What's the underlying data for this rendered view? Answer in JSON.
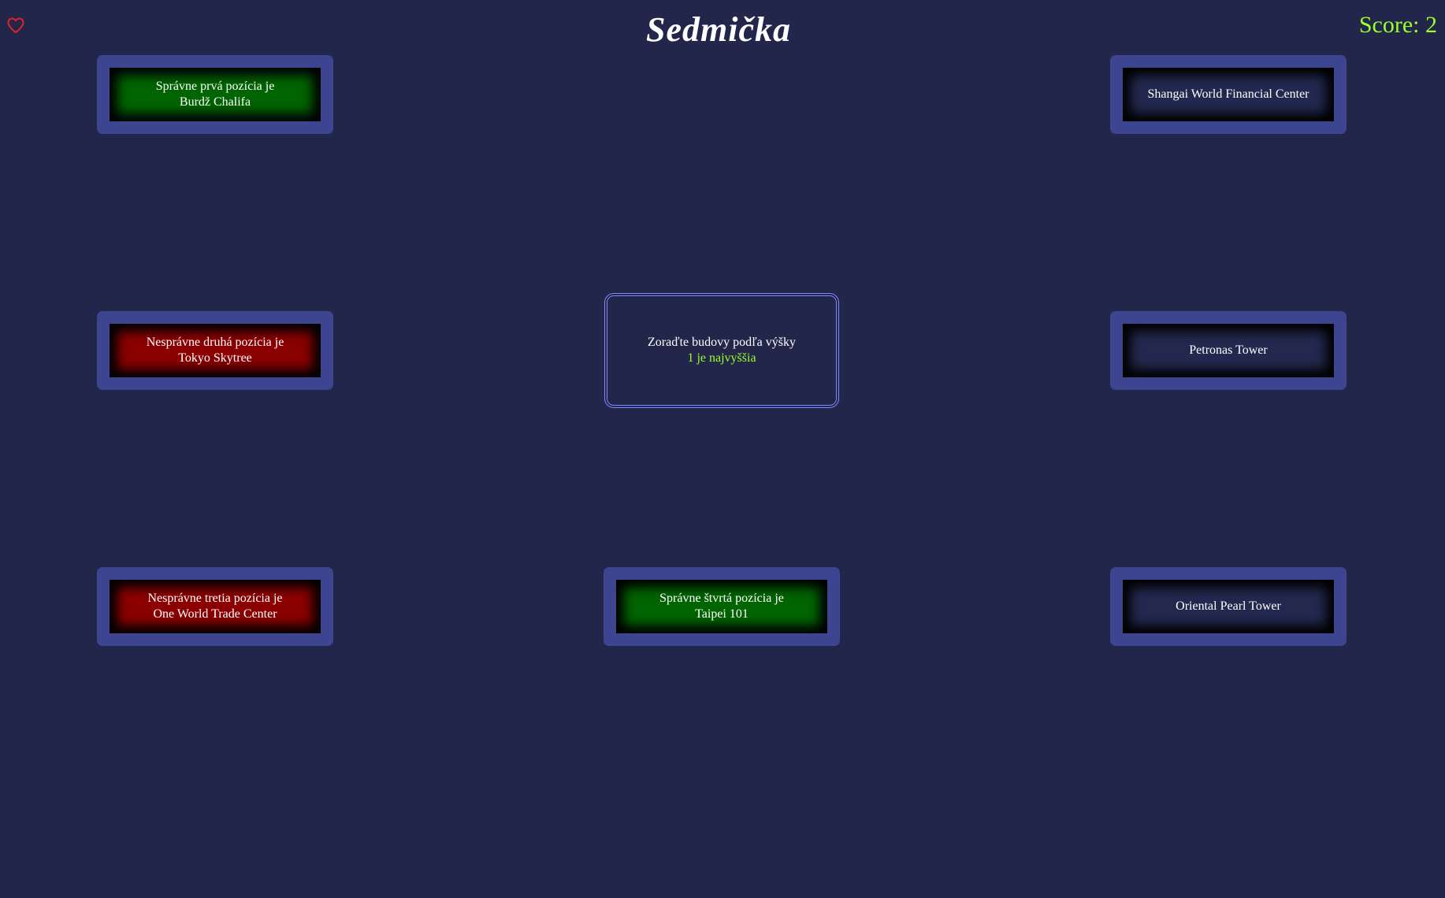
{
  "game": {
    "title": "Sedmička",
    "score_text": "Score: 2",
    "heart_icon": "heart-outline-icon",
    "colors": {
      "background": "#22264a",
      "card_frame": "#3d4490",
      "correct": "#006400",
      "wrong": "#8b0000",
      "accent": "#9aff2a",
      "heart": "#e0202a"
    }
  },
  "center": {
    "instruction": "Zoraďte budovy podľa výšky",
    "hint": "1 je najvyššia"
  },
  "cards": {
    "top_left": {
      "line1": "Správne prvá pozícia je",
      "line2": "Burdž Chalifa",
      "state": "correct"
    },
    "mid_left": {
      "line1": "Nesprávne druhá pozícia je",
      "line2": "Tokyo Skytree",
      "state": "wrong"
    },
    "bottom_left": {
      "line1": "Nesprávne tretia pozícia je",
      "line2": "One World Trade Center",
      "state": "wrong"
    },
    "bottom_mid": {
      "line1": "Správne štvrtá pozícia je",
      "line2": "Taipei 101",
      "state": "correct"
    },
    "top_right": {
      "label": "Shangai World Financial Center",
      "state": "neutral"
    },
    "mid_right": {
      "label": "Petronas Tower",
      "state": "neutral"
    },
    "bottom_right": {
      "label": "Oriental Pearl Tower",
      "state": "neutral"
    }
  }
}
